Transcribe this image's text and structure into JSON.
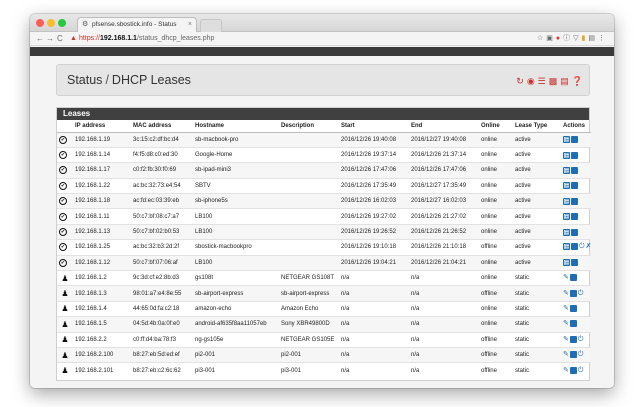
{
  "browser": {
    "tab_title": "pfsense.sbostick.info - Status",
    "tab_close": "×",
    "url_scheme": "https",
    "url_host": "192.168.1.1",
    "url_path": "/status_dhcp_leases.php",
    "nav": {
      "back": "←",
      "forward": "→",
      "reload": "C"
    },
    "toolbar_icons": [
      "star-icon",
      "shield-icon",
      "red-badge-icon",
      "info-icon",
      "pocket-icon",
      "extension-icon",
      "menu-icon"
    ]
  },
  "app_bar_text": "",
  "page": {
    "breadcrumb_parent": "Status",
    "breadcrumb_sep": "/",
    "breadcrumb_current": "DHCP Leases"
  },
  "panel": {
    "title": "Leases",
    "columns": [
      "",
      "IP address",
      "MAC address",
      "Hostname",
      "Description",
      "Start",
      "End",
      "Online",
      "Lease Type",
      "Actions"
    ]
  },
  "leases": [
    {
      "state": "active",
      "ip": "192.168.1.19",
      "mac": "3c:15:c2:df:bc:d4",
      "hostname": "sb-macbook-pro",
      "description": "",
      "start": "2016/12/26 19:40:08",
      "end": "2016/12/27 19:40:08",
      "online": "online",
      "type": "active",
      "actions": [
        "outline",
        "plus"
      ]
    },
    {
      "state": "active",
      "ip": "192.168.1.14",
      "mac": "f4:f5:d8:c0:ed:30",
      "hostname": "Google-Home",
      "description": "",
      "start": "2016/12/26 19:37:14",
      "end": "2016/12/26 21:37:14",
      "online": "online",
      "type": "active",
      "actions": [
        "outline",
        "plus"
      ]
    },
    {
      "state": "active",
      "ip": "192.168.1.17",
      "mac": "c0:f2:fb:30:f0:69",
      "hostname": "sb-ipad-mini3",
      "description": "",
      "start": "2016/12/26 17:47:06",
      "end": "2016/12/26 17:47:06",
      "online": "online",
      "type": "active",
      "actions": [
        "outline",
        "plus"
      ]
    },
    {
      "state": "active",
      "ip": "192.168.1.22",
      "mac": "ac:bc:32:73:e4:54",
      "hostname": "SBTV",
      "description": "",
      "start": "2016/12/26 17:35:49",
      "end": "2016/12/27 17:35:49",
      "online": "online",
      "type": "active",
      "actions": [
        "outline",
        "plus"
      ]
    },
    {
      "state": "active",
      "ip": "192.168.1.18",
      "mac": "ac:fd:ec:03:39:eb",
      "hostname": "sb-iphone5s",
      "description": "",
      "start": "2016/12/26 16:02:03",
      "end": "2016/12/27 16:02:03",
      "online": "online",
      "type": "active",
      "actions": [
        "outline",
        "plus"
      ]
    },
    {
      "state": "active",
      "ip": "192.168.1.11",
      "mac": "50:c7:bf:08:c7:a7",
      "hostname": "LB100",
      "description": "",
      "start": "2016/12/26 19:27:02",
      "end": "2016/12/26 21:27:02",
      "online": "online",
      "type": "active",
      "actions": [
        "outline",
        "plus"
      ]
    },
    {
      "state": "active",
      "ip": "192.168.1.13",
      "mac": "50:c7:bf:02:b0:53",
      "hostname": "LB100",
      "description": "",
      "start": "2016/12/26 19:26:52",
      "end": "2016/12/26 21:26:52",
      "online": "online",
      "type": "active",
      "actions": [
        "outline",
        "plus"
      ]
    },
    {
      "state": "active",
      "ip": "192.168.1.25",
      "mac": "ac:bc:32:b3:2d:2f",
      "hostname": "sbostick-macbookpro",
      "description": "",
      "start": "2016/12/26 19:10:18",
      "end": "2016/12/26 21:10:18",
      "online": "offline",
      "type": "active",
      "actions": [
        "outline",
        "plus",
        "power",
        "trash"
      ]
    },
    {
      "state": "active",
      "ip": "192.168.1.12",
      "mac": "50:c7:bf:07:06:af",
      "hostname": "LB100",
      "description": "",
      "start": "2016/12/26 19:04:21",
      "end": "2016/12/26 21:04:21",
      "online": "online",
      "type": "active",
      "actions": [
        "outline",
        "plus"
      ]
    },
    {
      "state": "static",
      "ip": "192.168.1.2",
      "mac": "9c:3d:cf:e2:8b:d3",
      "hostname": "gs108t",
      "description": "NETGEAR GS108T",
      "start": "n/a",
      "end": "n/a",
      "online": "online",
      "type": "static",
      "actions": [
        "pencil",
        "plus"
      ]
    },
    {
      "state": "static",
      "ip": "192.168.1.3",
      "mac": "98:01:a7:e4:8e:55",
      "hostname": "sb-airport-express",
      "description": "sb-airport-express",
      "start": "n/a",
      "end": "n/a",
      "online": "offline",
      "type": "static",
      "actions": [
        "pencil",
        "plus",
        "power"
      ]
    },
    {
      "state": "static",
      "ip": "192.168.1.4",
      "mac": "44:65:0d:fa:c2:18",
      "hostname": "amazon-echo",
      "description": "Amazon Echo",
      "start": "n/a",
      "end": "n/a",
      "online": "online",
      "type": "static",
      "actions": [
        "pencil",
        "plus"
      ]
    },
    {
      "state": "static",
      "ip": "192.168.1.5",
      "mac": "04:5d:4b:0a:0f:e0",
      "hostname": "android-af635f8aa11057eb",
      "description": "Sony XBR49800D",
      "start": "n/a",
      "end": "n/a",
      "online": "online",
      "type": "static",
      "actions": [
        "pencil",
        "plus"
      ]
    },
    {
      "state": "static",
      "ip": "192.168.2.2",
      "mac": "c0:ff:d4:ba:78:f3",
      "hostname": "ng-gs105e",
      "description": "NETGEAR GS105E",
      "start": "n/a",
      "end": "n/a",
      "online": "offline",
      "type": "static",
      "actions": [
        "pencil",
        "plus",
        "power"
      ]
    },
    {
      "state": "static",
      "ip": "192.168.2.100",
      "mac": "b8:27:eb:5d:ed:ef",
      "hostname": "pi2-001",
      "description": "pi2-001",
      "start": "n/a",
      "end": "n/a",
      "online": "offline",
      "type": "static",
      "actions": [
        "pencil",
        "plus",
        "power"
      ]
    },
    {
      "state": "static",
      "ip": "192.168.2.101",
      "mac": "b8:27:eb:c2:6c:62",
      "hostname": "pi3-001",
      "description": "pi3-001",
      "start": "n/a",
      "end": "n/a",
      "online": "offline",
      "type": "static",
      "actions": [
        "pencil",
        "plus",
        "power"
      ]
    }
  ],
  "icons": {
    "active_state": "check-circle-icon",
    "static_state": "user-icon",
    "header": [
      "reload-icon",
      "stop-icon",
      "sliders-icon",
      "chart-icon",
      "table-icon",
      "help-icon"
    ]
  },
  "colors": {
    "accent": "#1f6db5",
    "header_icon": "#c8312d",
    "panel_header": "#404040"
  }
}
